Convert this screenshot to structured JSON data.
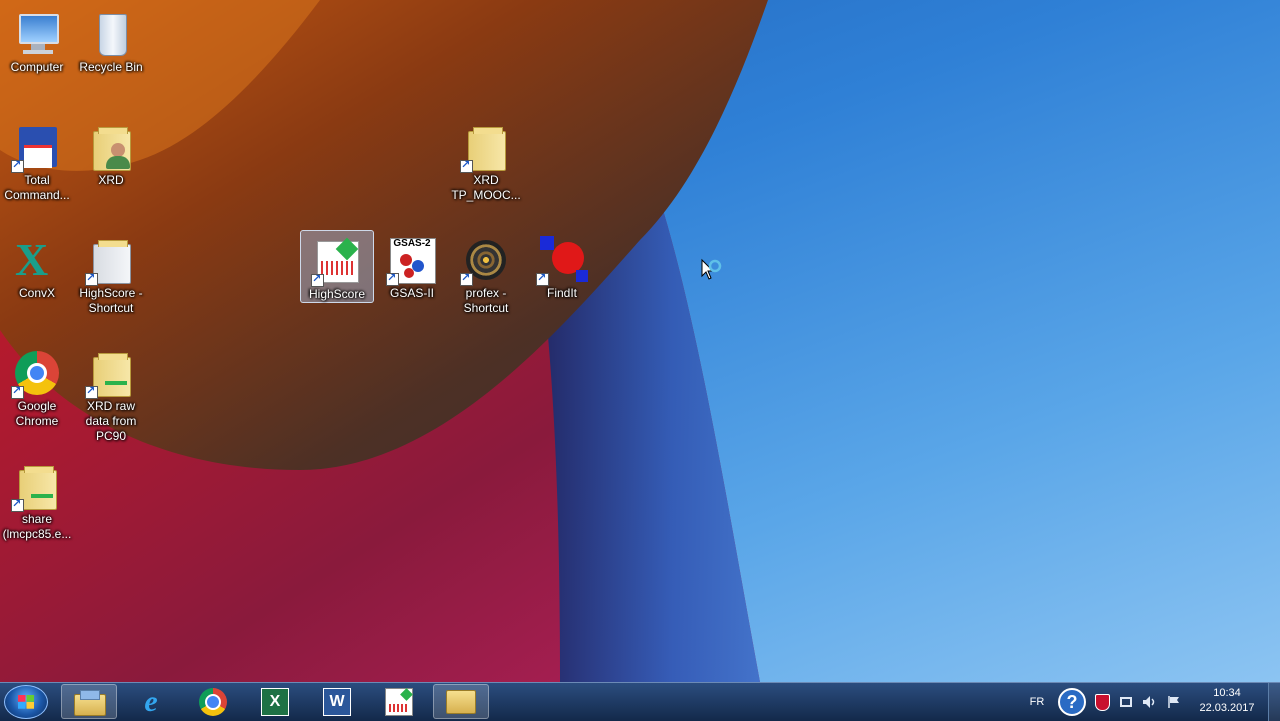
{
  "desktop_icons": [
    {
      "id": "computer",
      "label": "Computer"
    },
    {
      "id": "recycle",
      "label": "Recycle Bin"
    },
    {
      "id": "totalcmd",
      "label": "Total Command..."
    },
    {
      "id": "xrd",
      "label": "XRD"
    },
    {
      "id": "xrd_tp",
      "label": "XRD TP_MOOC..."
    },
    {
      "id": "convx",
      "label": "ConvX"
    },
    {
      "id": "highscore_shortcut",
      "label": "HighScore - Shortcut"
    },
    {
      "id": "highscore",
      "label": "HighScore"
    },
    {
      "id": "gsas",
      "label": "GSAS-II"
    },
    {
      "id": "profex",
      "label": "profex - Shortcut"
    },
    {
      "id": "findit",
      "label": "FindIt"
    },
    {
      "id": "chrome",
      "label": "Google Chrome"
    },
    {
      "id": "xrd_raw",
      "label": "XRD raw data from PC90"
    },
    {
      "id": "share",
      "label": "share (lmcpc85.e..."
    }
  ],
  "gsas_badge": "GSAS-2",
  "taskbar": {
    "pinned": [
      "Windows Explorer",
      "Internet Explorer",
      "Google Chrome",
      "Microsoft Excel",
      "Microsoft Word",
      "HighScore",
      "Folder"
    ],
    "excel_letter": "X",
    "word_letter": "W"
  },
  "tray": {
    "language": "FR",
    "help_glyph": "?",
    "time": "10:34",
    "date": "22.03.2017"
  }
}
